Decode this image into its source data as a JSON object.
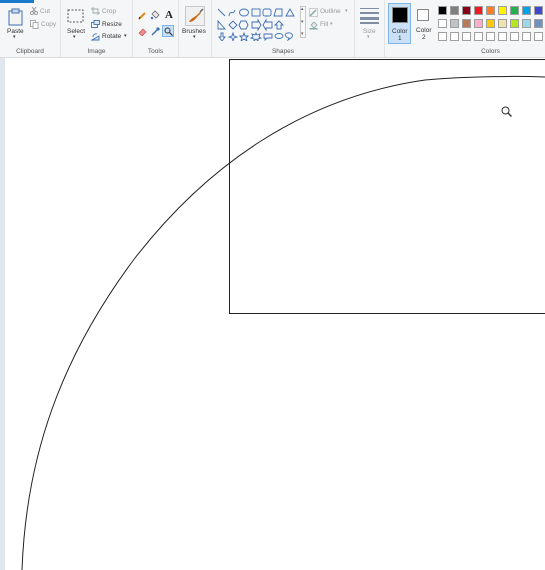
{
  "ribbon": {
    "clipboard": {
      "group_label": "Clipboard",
      "paste": "Paste",
      "cut": "Cut",
      "copy": "Copy"
    },
    "image": {
      "group_label": "Image",
      "select": "Select",
      "crop": "Crop",
      "resize": "Resize",
      "rotate": "Rotate"
    },
    "tools": {
      "group_label": "Tools"
    },
    "brushes": {
      "label": "Brushes"
    },
    "shapes": {
      "group_label": "Shapes",
      "outline": "Outline",
      "fill": "Fill"
    },
    "size": {
      "label": "Size"
    },
    "color1": {
      "label_line1": "Color",
      "label_line2": "1",
      "value": "#000000"
    },
    "color2": {
      "label_line1": "Color",
      "label_line2": "2",
      "value": "#ffffff"
    },
    "colors": {
      "group_label": "Colors",
      "row1": [
        "#000000",
        "#7f7f7f",
        "#880015",
        "#ed1c24",
        "#ff7f27",
        "#fff200",
        "#22b14c",
        "#00a2e8",
        "#3f48cc"
      ],
      "row2": [
        "#ffffff",
        "#c3c3c3",
        "#b97a57",
        "#ffaec9",
        "#ffc90e",
        "#efe4b0",
        "#b5e61d",
        "#99d9ea",
        "#7092be"
      ],
      "row3": [
        "#ffffff",
        "#ffffff",
        "#ffffff",
        "#ffffff",
        "#ffffff",
        "#ffffff",
        "#ffffff",
        "#ffffff",
        "#ffffff"
      ]
    }
  }
}
